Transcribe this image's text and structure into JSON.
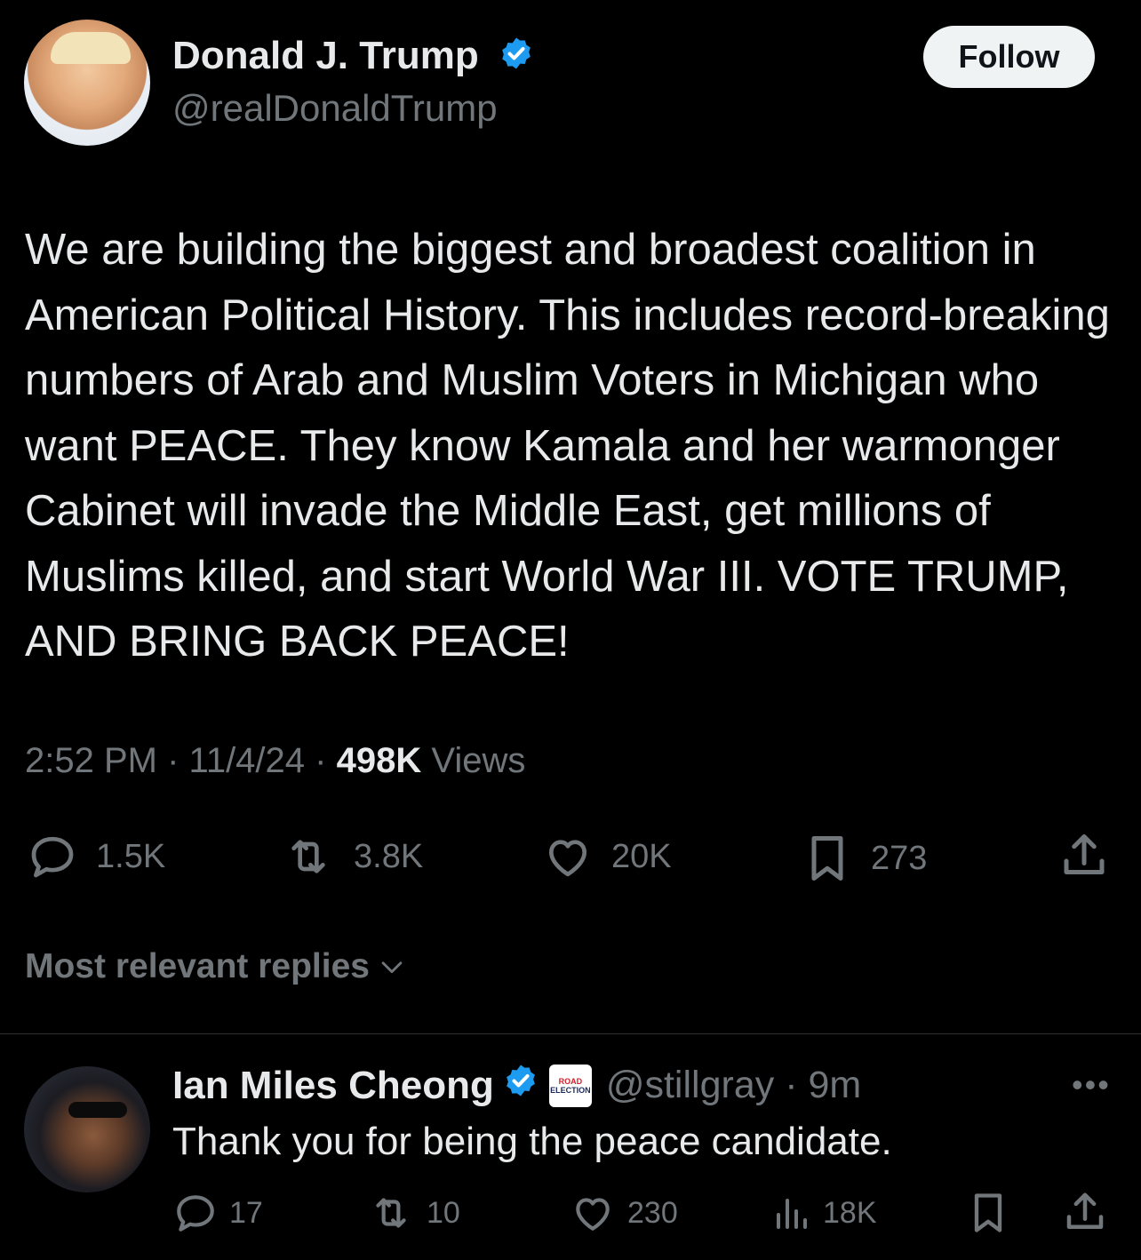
{
  "author": {
    "name": "Donald J. Trump",
    "handle": "@realDonaldTrump",
    "verified": true
  },
  "follow_label": "Follow",
  "tweet": {
    "text": "We are building the biggest and broadest coalition in American Political History. This includes record-breaking numbers of Arab and Muslim Voters in Michigan who want PEACE. They know Kamala and her warmonger Cabinet will invade the Middle East, get millions of Muslims killed, and start World War III. VOTE TRUMP, AND BRING BACK PEACE!",
    "time": "2:52 PM",
    "date": "11/4/24",
    "views_count": "498K",
    "views_label": "Views",
    "separator": "·"
  },
  "actions": {
    "replies": "1.5K",
    "reposts": "3.8K",
    "likes": "20K",
    "bookmarks": "273"
  },
  "sort_label": "Most relevant replies",
  "reply": {
    "name": "Ian Miles Cheong",
    "handle": "@stillgray",
    "time": "9m",
    "affiliate_badge_line1": "ROAD",
    "affiliate_badge_line2": "ELECTION",
    "text": "Thank you for being the peace candidate.",
    "replies": "17",
    "reposts": "10",
    "likes": "230",
    "views": "18K"
  },
  "colors": {
    "background": "#000000",
    "text": "#e7e9ea",
    "secondary": "#71767b",
    "verified_blue": "#1d9bf0"
  }
}
